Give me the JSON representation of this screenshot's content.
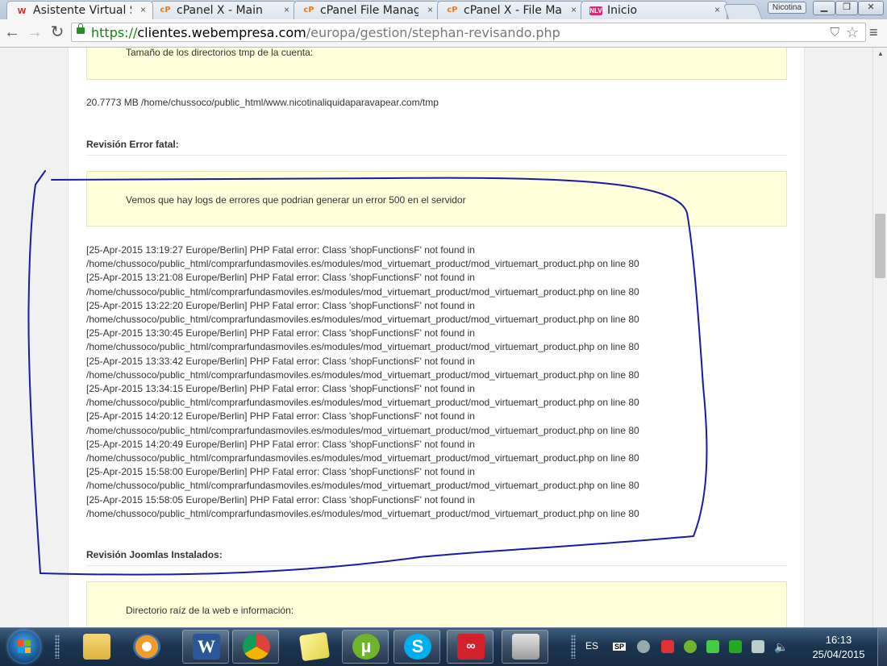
{
  "browser": {
    "tabs": [
      {
        "favicon": "w",
        "label": "Asistente Virtual Ste",
        "close": "×"
      },
      {
        "favicon": "cP",
        "label": "cPanel X - Main",
        "close": "×"
      },
      {
        "favicon": "cP",
        "label": "cPanel File Manager",
        "close": "×"
      },
      {
        "favicon": "cP",
        "label": "cPanel X - File Mana",
        "close": "×"
      },
      {
        "favicon": "NLV",
        "label": "Inicio",
        "close": "×"
      }
    ],
    "profile_name": "Nicotina",
    "url_scheme": "https://",
    "url_host": "clientes.webempresa.com",
    "url_path": "/europa/gestion/stephan-revisando.php",
    "icons": [
      "back-icon",
      "forward-icon",
      "reload-icon",
      "lock-icon",
      "shield-icon",
      "star-icon",
      "menu-icon"
    ]
  },
  "page": {
    "tmp_notice": "Tamaño de los directorios tmp de la cuenta:",
    "tmp_value": "20.7773 MB /home/chussoco/public_html/www.nicotinaliquidaparavapear.com/tmp",
    "fatal_title": "Revisión Error fatal:",
    "fatal_notice": "Vemos que hay logs de errores que podrian generar un error 500 en el servidor",
    "log_lines": [
      "[25-Apr-2015 13:19:27 Europe/Berlin] PHP Fatal error: Class 'shopFunctionsF' not found in",
      "/home/chussoco/public_html/comprarfundasmoviles.es/modules/mod_virtuemart_product/mod_virtuemart_product.php on line 80",
      "[25-Apr-2015 13:21:08 Europe/Berlin] PHP Fatal error: Class 'shopFunctionsF' not found in",
      "/home/chussoco/public_html/comprarfundasmoviles.es/modules/mod_virtuemart_product/mod_virtuemart_product.php on line 80",
      "[25-Apr-2015 13:22:20 Europe/Berlin] PHP Fatal error: Class 'shopFunctionsF' not found in",
      "/home/chussoco/public_html/comprarfundasmoviles.es/modules/mod_virtuemart_product/mod_virtuemart_product.php on line 80",
      "[25-Apr-2015 13:30:45 Europe/Berlin] PHP Fatal error: Class 'shopFunctionsF' not found in",
      "/home/chussoco/public_html/comprarfundasmoviles.es/modules/mod_virtuemart_product/mod_virtuemart_product.php on line 80",
      "[25-Apr-2015 13:33:42 Europe/Berlin] PHP Fatal error: Class 'shopFunctionsF' not found in",
      "/home/chussoco/public_html/comprarfundasmoviles.es/modules/mod_virtuemart_product/mod_virtuemart_product.php on line 80",
      "[25-Apr-2015 13:34:15 Europe/Berlin] PHP Fatal error: Class 'shopFunctionsF' not found in",
      "/home/chussoco/public_html/comprarfundasmoviles.es/modules/mod_virtuemart_product/mod_virtuemart_product.php on line 80",
      "[25-Apr-2015 14:20:12 Europe/Berlin] PHP Fatal error: Class 'shopFunctionsF' not found in",
      "/home/chussoco/public_html/comprarfundasmoviles.es/modules/mod_virtuemart_product/mod_virtuemart_product.php on line 80",
      "[25-Apr-2015 14:20:49 Europe/Berlin] PHP Fatal error: Class 'shopFunctionsF' not found in",
      "/home/chussoco/public_html/comprarfundasmoviles.es/modules/mod_virtuemart_product/mod_virtuemart_product.php on line 80",
      "[25-Apr-2015 15:58:00 Europe/Berlin] PHP Fatal error: Class 'shopFunctionsF' not found in",
      "/home/chussoco/public_html/comprarfundasmoviles.es/modules/mod_virtuemart_product/mod_virtuemart_product.php on line 80",
      "[25-Apr-2015 15:58:05 Europe/Berlin] PHP Fatal error: Class 'shopFunctionsF' not found in",
      "/home/chussoco/public_html/comprarfundasmoviles.es/modules/mod_virtuemart_product/mod_virtuemart_product.php on line 80"
    ],
    "joomla_title": "Revisión Joomlas Instalados:",
    "root_notice": "Directorio raíz de la web e información:",
    "colors": {
      "notice_bg": "#ffffd9",
      "annotation_stroke": "#1a1aa8"
    }
  },
  "taskbar": {
    "pinned": [
      "explorer-icon",
      "media-player-icon",
      "word-icon",
      "chrome-icon",
      "sticky-notes-icon",
      "utorrent-icon",
      "skype-icon",
      "adobe-cc-icon",
      "camera-icon"
    ],
    "language": "ES",
    "tray_label": "SP",
    "time": "16:13",
    "date": "25/04/2015"
  }
}
